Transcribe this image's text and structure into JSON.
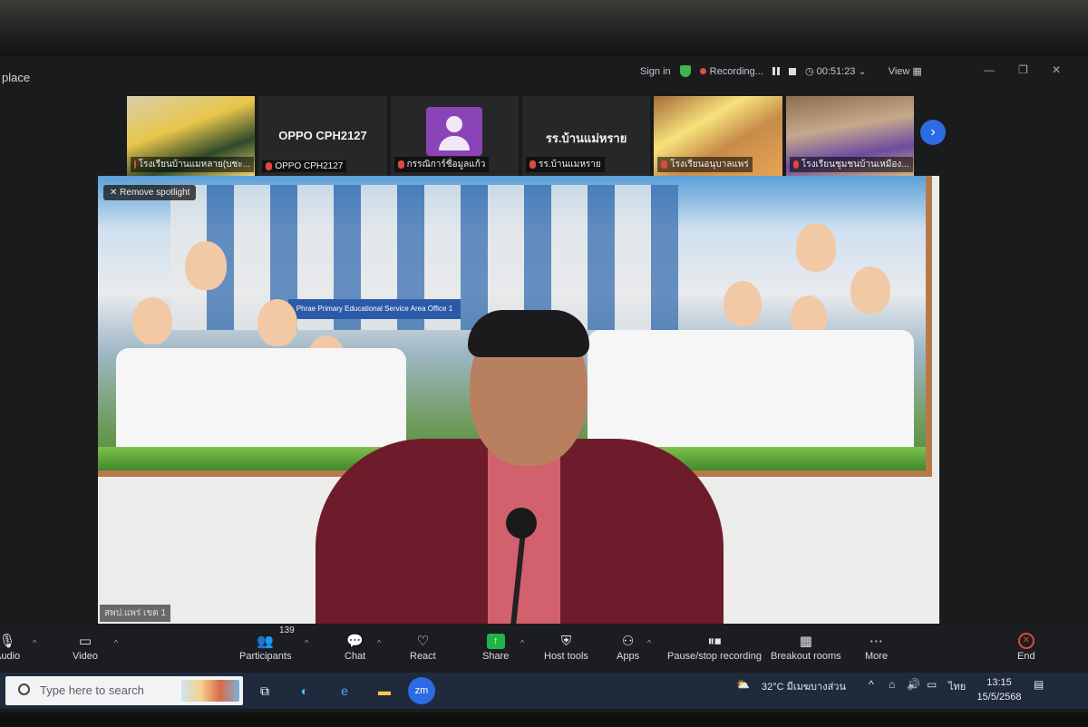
{
  "window": {
    "app_title": "place",
    "sign_in": "Sign in",
    "recording": "Recording...",
    "timer": "00:51:23",
    "view": "View"
  },
  "participants": [
    {
      "label": "โรงเรียนบ้านแมหลาย(บชะ...",
      "display": ""
    },
    {
      "label": "OPPO CPH2127",
      "display": "OPPO CPH2127"
    },
    {
      "label": "กรรณิการ์ชื่อมูลแก้ว",
      "display": ""
    },
    {
      "label": "รร.บ้านแมหราย",
      "display": "รร.บ้านแม่หราย"
    },
    {
      "label": "โรงเรียนอนุบาลแพร่",
      "display": ""
    },
    {
      "label": "โรงเรียนชุมชนบ้านเหมือง...",
      "display": ""
    }
  ],
  "main": {
    "remove_spotlight": "Remove spotlight",
    "office_sign": "Phrae Primary Educational Service Area Office 1",
    "speaker_name": "สพป.แพร่ เขต 1"
  },
  "toolbar": {
    "audio": "Audio",
    "video": "Video",
    "participants": "Participants",
    "participants_count": "139",
    "chat": "Chat",
    "react": "React",
    "share": "Share",
    "host_tools": "Host tools",
    "apps": "Apps",
    "pause_stop": "Pause/stop recording",
    "breakout": "Breakout rooms",
    "more": "More",
    "end": "End"
  },
  "taskbar": {
    "search_placeholder": "Type here to search",
    "zoom_app": "zm",
    "weather": "32°C มีเมฆบางส่วน",
    "lang": "ไทย",
    "time": "13:15",
    "date": "15/5/2568"
  },
  "colors": {
    "share": "#20b34d",
    "end": "#e0483c",
    "next": "#2d6be4",
    "avatar": "#8a44b8"
  }
}
